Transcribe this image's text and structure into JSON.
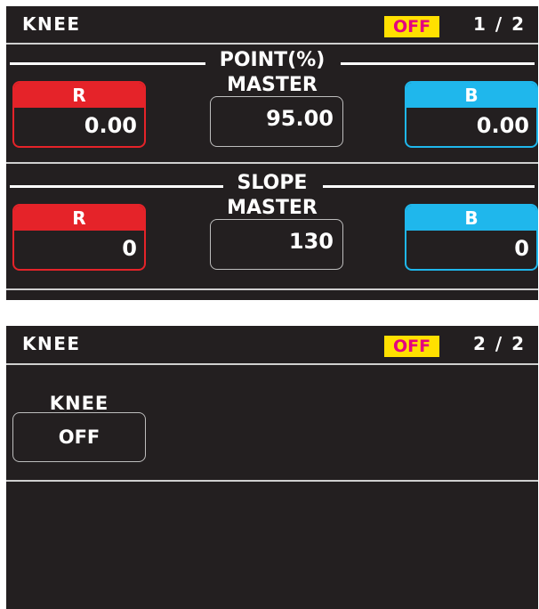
{
  "screens": [
    {
      "title": "KNEE",
      "status": "OFF",
      "page": "1 / 2",
      "point": {
        "title": "POINT(%)",
        "master_label": "MASTER",
        "r_label": "R",
        "r_value": "0.00",
        "master_value": "95.00",
        "b_label": "B",
        "b_value": "0.00"
      },
      "slope": {
        "title": "SLOPE",
        "master_label": "MASTER",
        "r_label": "R",
        "r_value": "0",
        "master_value": "130",
        "b_label": "B",
        "b_value": "0"
      }
    },
    {
      "title": "KNEE",
      "status": "OFF",
      "page": "2 / 2",
      "knee": {
        "label": "KNEE",
        "value": "OFF"
      }
    }
  ],
  "colors": {
    "background": "#231f20",
    "red": "#e52329",
    "blue": "#1fb7ec",
    "status_bg": "#ffe000",
    "status_text": "#e4007f"
  }
}
